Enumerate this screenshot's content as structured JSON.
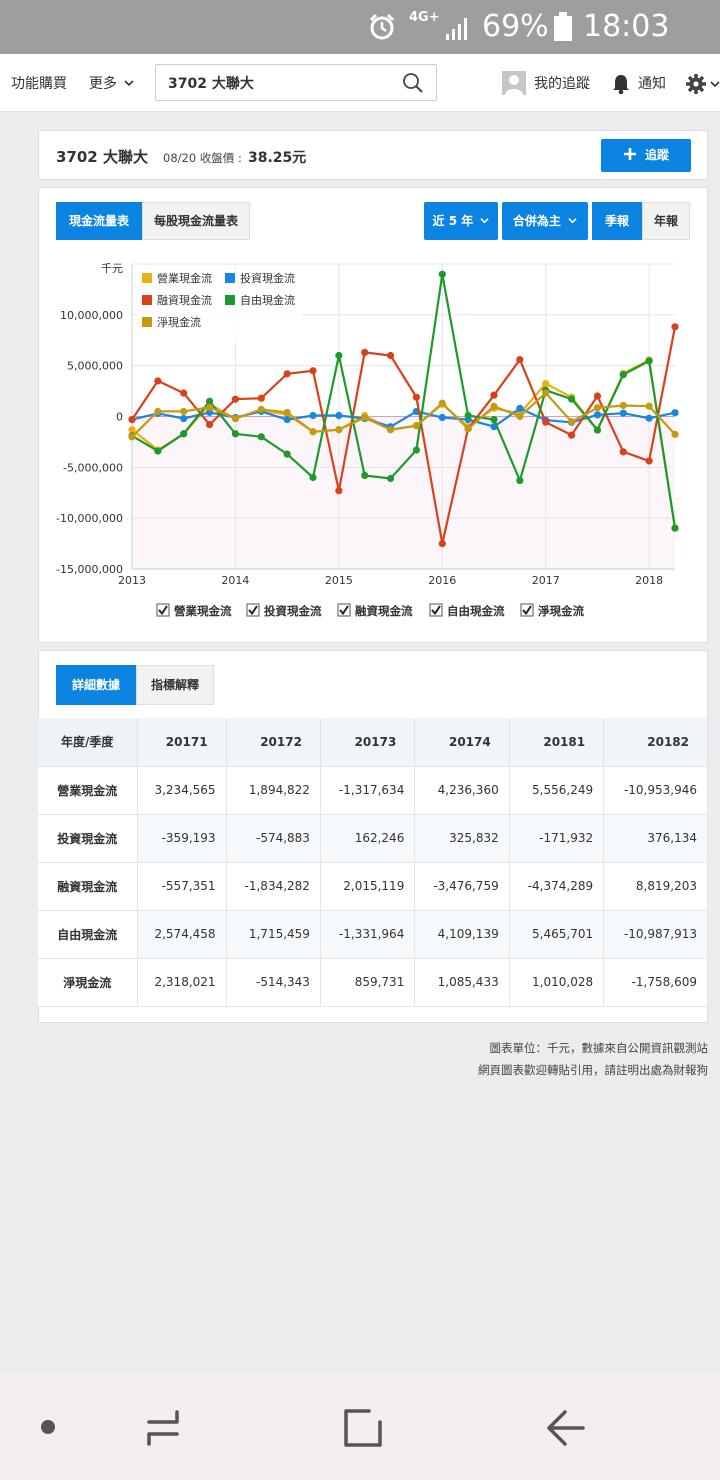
{
  "status_bar": {
    "network": "4G+",
    "battery": "69%",
    "time": "18:03"
  },
  "nav": {
    "buy": "功能購買",
    "more": "更多",
    "search_value": "3702 大聯大",
    "track": "我的追蹤",
    "notify": "通知"
  },
  "stock": {
    "title": "3702 大聯大",
    "date_label": "08/20 收盤價 :",
    "price": "38.25元",
    "follow_button": "追蹤"
  },
  "chart_tabs": {
    "cashflow": "現金流量表",
    "per_share": "每股現金流量表",
    "period": "近 5 年",
    "consolidated": "合併為主",
    "quarterly": "季報",
    "yearly": "年報"
  },
  "detail_tabs": {
    "detail": "詳細數據",
    "explain": "指標解釋"
  },
  "chart_data": {
    "type": "line",
    "unit_label": "千元",
    "x": [
      2013.0,
      2013.25,
      2013.5,
      2013.75,
      2014.0,
      2014.25,
      2014.5,
      2014.75,
      2015.0,
      2015.25,
      2015.5,
      2015.75,
      2016.0,
      2016.25,
      2016.5,
      2016.75,
      2017.0,
      2017.25,
      2017.5,
      2017.75,
      2018.0,
      2018.25
    ],
    "xlim": [
      2013.0,
      2018.25
    ],
    "x_ticks": [
      2013,
      2014,
      2015,
      2016,
      2017,
      2018
    ],
    "ylim": [
      -15000000,
      15000000
    ],
    "y_ticks": [
      10000000,
      5000000,
      0,
      -5000000,
      -10000000,
      -15000000
    ],
    "y_tick_labels": [
      "10,000,000",
      "5,000,000",
      "0",
      "-5,000,000",
      "-10,000,000",
      "-15,000,000"
    ],
    "legend_position": "top-left",
    "grid": true,
    "series": [
      {
        "name": "營業現金流",
        "color": "#e8b10e",
        "values": [
          -1300000,
          -3300000,
          -1700000,
          1200000,
          -200000,
          600000,
          200000,
          -1500000,
          -1300000,
          100000,
          -1300000,
          -900000,
          1200000,
          -1000000,
          800000,
          300000,
          3234565,
          1894822,
          -1317634,
          4236360,
          5556249,
          -10953946
        ]
      },
      {
        "name": "投資現金流",
        "color": "#1a86e3",
        "values": [
          -300000,
          300000,
          -200000,
          400000,
          -100000,
          500000,
          -300000,
          100000,
          100000,
          -200000,
          -1000000,
          500000,
          -100000,
          -300000,
          -1000000,
          800000,
          -359193,
          -574883,
          162246,
          325832,
          -171932,
          376134
        ]
      },
      {
        "name": "融資現金流",
        "color": "#d9401c",
        "values": [
          -300000,
          3500000,
          2300000,
          -800000,
          1700000,
          1800000,
          4200000,
          4500000,
          -7300000,
          6300000,
          6000000,
          1900000,
          -12500000,
          -1200000,
          2100000,
          5600000,
          -557351,
          -1834282,
          2015119,
          -3476759,
          -4374289,
          8819203
        ]
      },
      {
        "name": "自由現金流",
        "color": "#1d9a2b",
        "values": [
          -1900000,
          -3400000,
          -1700000,
          1500000,
          -1700000,
          -2000000,
          -3700000,
          -6000000,
          6000000,
          -5800000,
          -6100000,
          -3300000,
          14000000,
          100000,
          -300000,
          -6300000,
          2574458,
          1715459,
          -1331964,
          4109139,
          5465701,
          -10987913
        ]
      },
      {
        "name": "淨現金流",
        "color": "#c49a12",
        "values": [
          -2000000,
          500000,
          500000,
          900000,
          -200000,
          700000,
          400000,
          -1500000,
          -1300000,
          -100000,
          -1300000,
          -900000,
          1300000,
          -1200000,
          1000000,
          0,
          2318021,
          -514343,
          859731,
          1085433,
          1010028,
          -1758609
        ]
      }
    ]
  },
  "table": {
    "header_label": "年度/季度",
    "columns": [
      "20171",
      "20172",
      "20173",
      "20174",
      "20181",
      "20182"
    ],
    "rows": [
      {
        "label": "營業現金流",
        "values": [
          "3,234,565",
          "1,894,822",
          "-1,317,634",
          "4,236,360",
          "5,556,249",
          "-10,953,946"
        ]
      },
      {
        "label": "投資現金流",
        "values": [
          "-359,193",
          "-574,883",
          "162,246",
          "325,832",
          "-171,932",
          "376,134"
        ]
      },
      {
        "label": "融資現金流",
        "values": [
          "-557,351",
          "-1,834,282",
          "2,015,119",
          "-3,476,759",
          "-4,374,289",
          "8,819,203"
        ]
      },
      {
        "label": "自由現金流",
        "values": [
          "2,574,458",
          "1,715,459",
          "-1,331,964",
          "4,109,139",
          "5,465,701",
          "-10,987,913"
        ]
      },
      {
        "label": "淨現金流",
        "values": [
          "2,318,021",
          "-514,343",
          "859,731",
          "1,085,433",
          "1,010,028",
          "-1,758,609"
        ]
      }
    ]
  },
  "footnotes": {
    "line1": "圖表單位：千元，數據來自公開資訊觀測站",
    "line2": "網頁圖表歡迎轉貼引用，請註明出處為財報狗"
  }
}
